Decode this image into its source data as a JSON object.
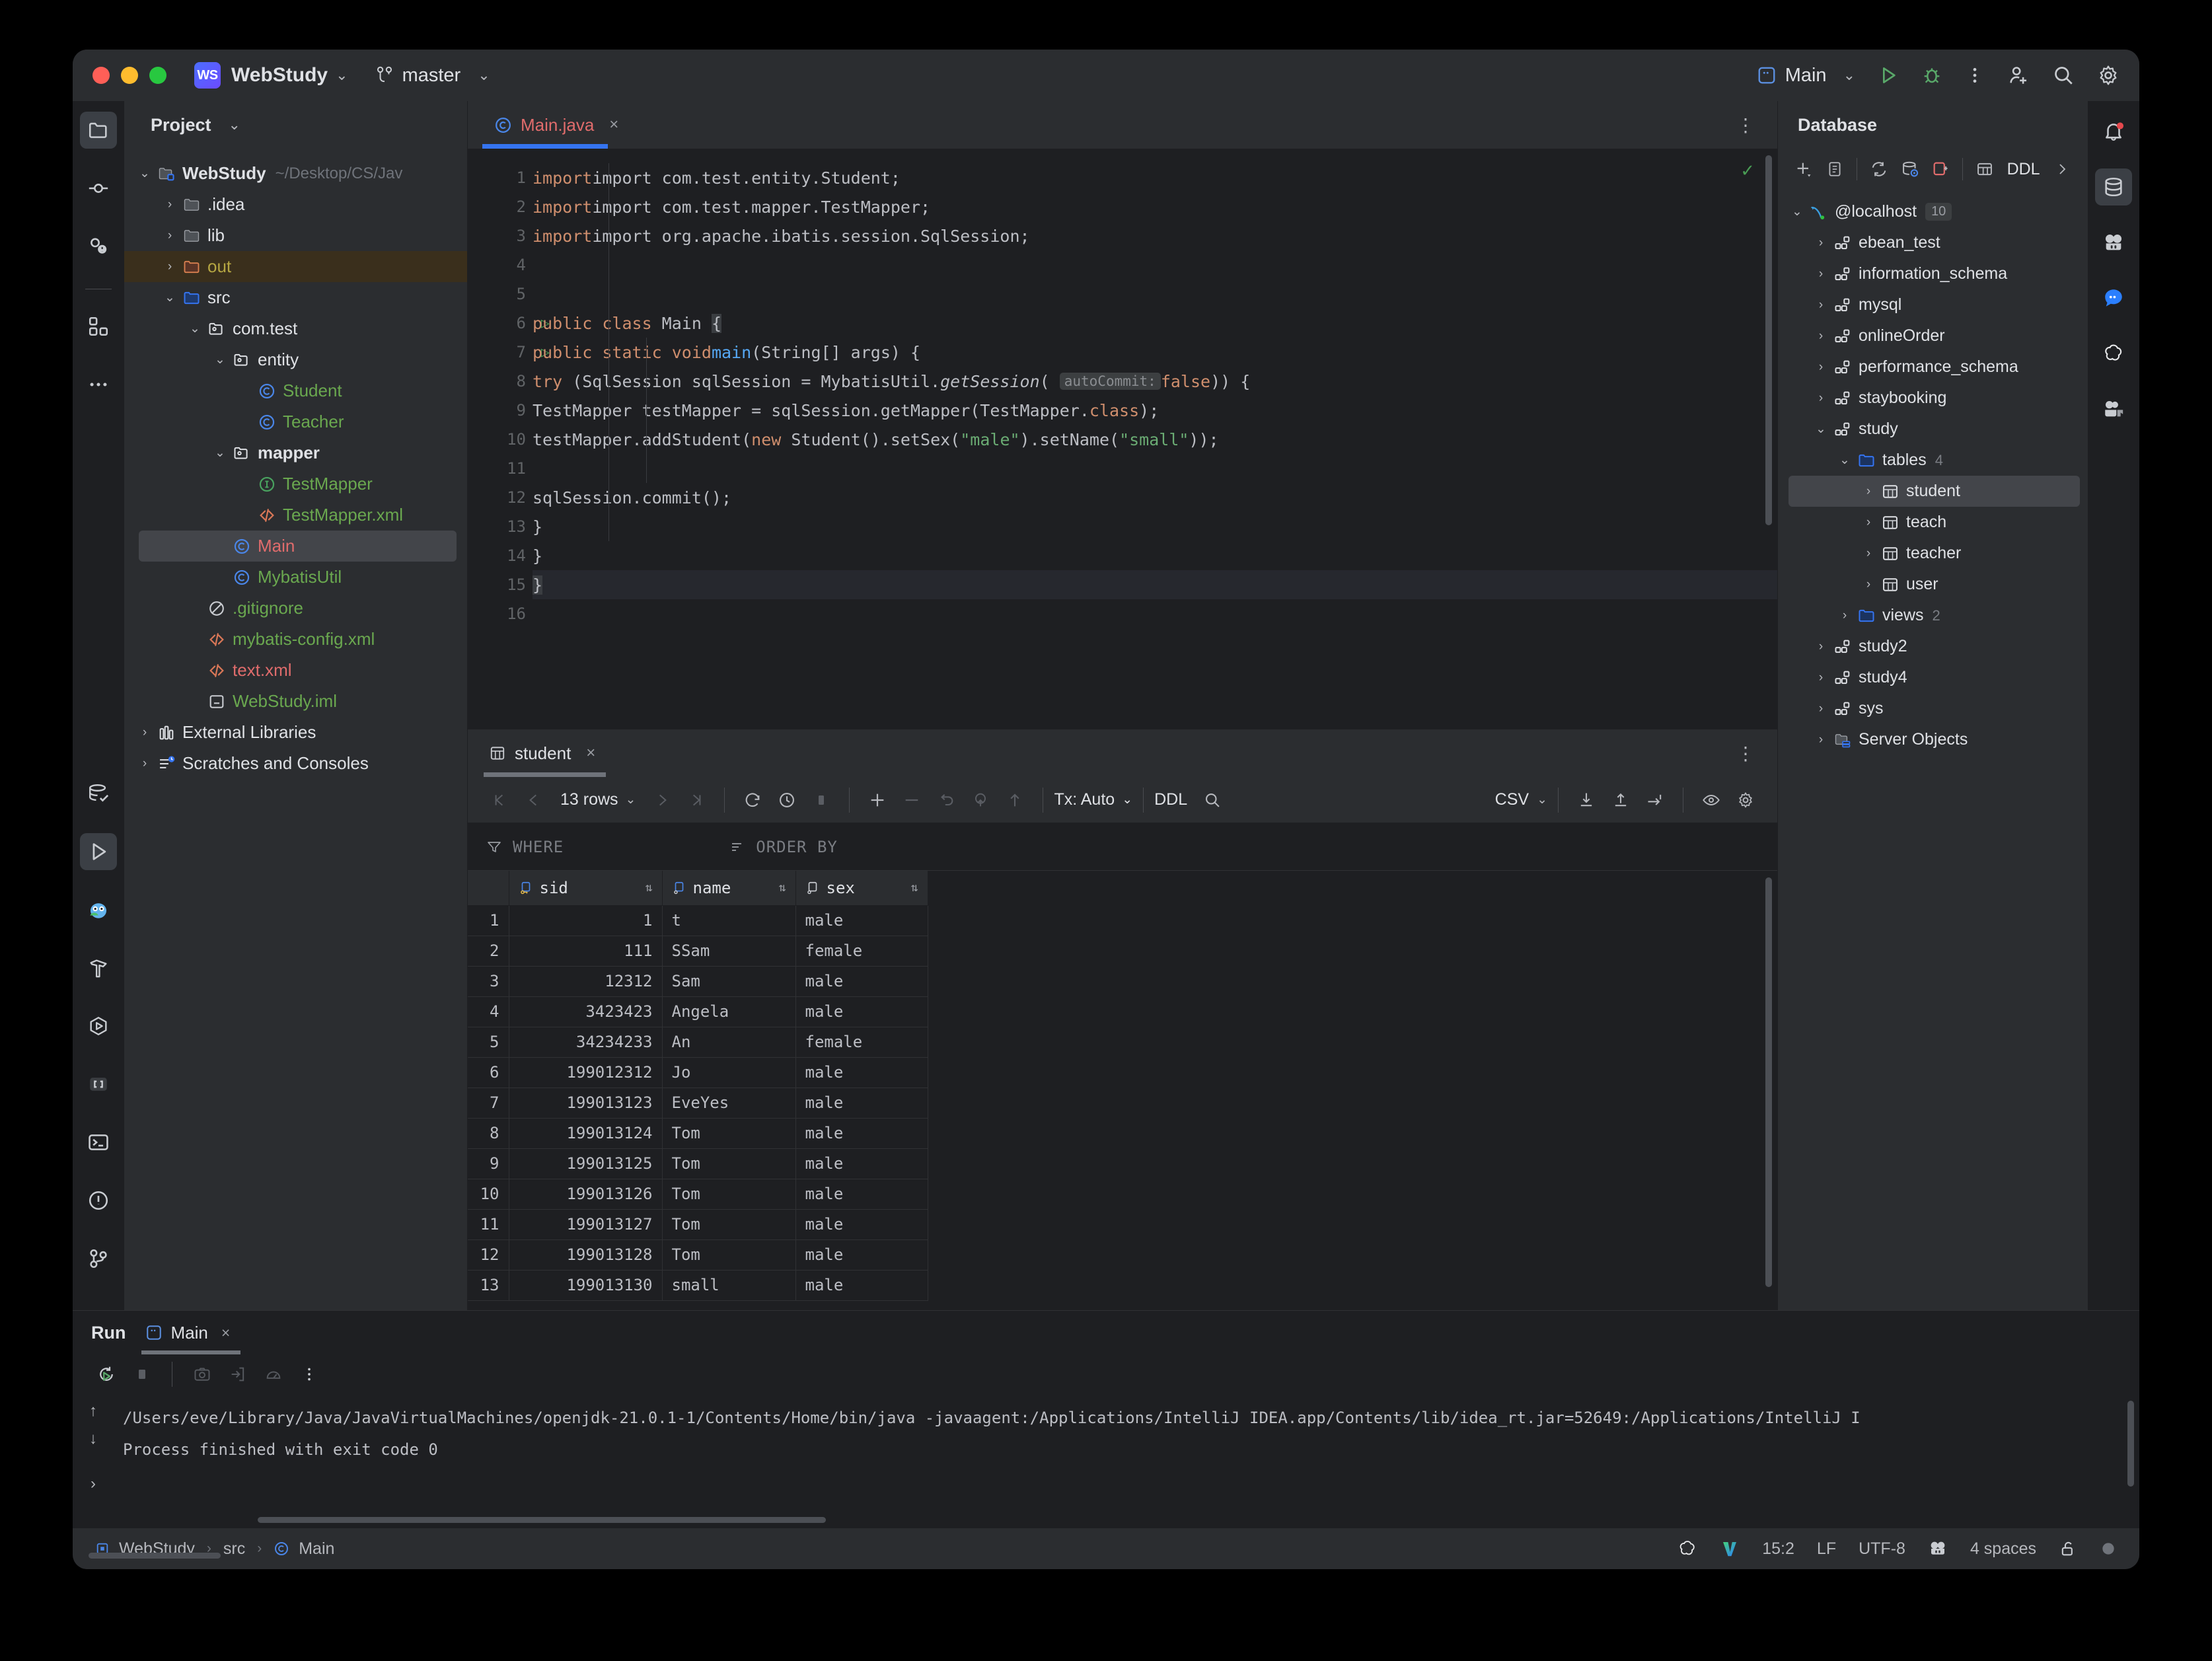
{
  "titlebar": {
    "project_badge": "WS",
    "project_name": "WebStudy",
    "branch": "master",
    "run_config": "Main",
    "icons": [
      "run-icon",
      "debug-icon",
      "more-options-icon",
      "add-user-icon",
      "search-icon",
      "settings-icon"
    ]
  },
  "project_panel": {
    "title": "Project",
    "tree": [
      {
        "label": "WebStudy",
        "path": "~/Desktop/CS/Jav",
        "icon": "module-folder-icon",
        "arrow": "expanded",
        "indent": 0,
        "style": "bold",
        "color": "white",
        "state": "normal"
      },
      {
        "label": ".idea",
        "icon": "folder-icon",
        "arrow": "collapsed",
        "indent": 1,
        "color": "white",
        "state": "normal"
      },
      {
        "label": "lib",
        "icon": "folder-icon",
        "arrow": "collapsed",
        "indent": 1,
        "color": "white",
        "state": "normal"
      },
      {
        "label": "out",
        "icon": "folder-excluded-icon",
        "arrow": "collapsed",
        "indent": 1,
        "color": "yellow",
        "state": "highlighted"
      },
      {
        "label": "src",
        "icon": "source-folder-icon",
        "arrow": "expanded",
        "indent": 1,
        "color": "white",
        "state": "normal"
      },
      {
        "label": "com.test",
        "icon": "package-icon",
        "arrow": "expanded",
        "indent": 2,
        "color": "white",
        "state": "normal"
      },
      {
        "label": "entity",
        "icon": "package-icon",
        "arrow": "expanded",
        "indent": 3,
        "color": "white",
        "state": "normal"
      },
      {
        "label": "Student",
        "icon": "java-class-icon",
        "arrow": "none",
        "indent": 4,
        "color": "green",
        "state": "normal"
      },
      {
        "label": "Teacher",
        "icon": "java-class-icon",
        "arrow": "none",
        "indent": 4,
        "color": "green",
        "state": "normal"
      },
      {
        "label": "mapper",
        "icon": "package-icon",
        "arrow": "expanded",
        "indent": 3,
        "color": "white",
        "style": "bold",
        "state": "normal"
      },
      {
        "label": "TestMapper",
        "icon": "java-interface-icon",
        "arrow": "none",
        "indent": 4,
        "color": "green",
        "state": "normal"
      },
      {
        "label": "TestMapper.xml",
        "icon": "xml-file-icon",
        "arrow": "none",
        "indent": 4,
        "color": "green",
        "state": "normal"
      },
      {
        "label": "Main",
        "icon": "java-class-icon",
        "arrow": "none",
        "indent": 3,
        "color": "red",
        "state": "selected"
      },
      {
        "label": "MybatisUtil",
        "icon": "java-class-icon",
        "arrow": "none",
        "indent": 3,
        "color": "green",
        "state": "normal"
      },
      {
        "label": ".gitignore",
        "icon": "gitignore-icon",
        "arrow": "none",
        "indent": 2,
        "color": "green",
        "state": "normal"
      },
      {
        "label": "mybatis-config.xml",
        "icon": "xml-file-icon",
        "arrow": "none",
        "indent": 2,
        "color": "green",
        "state": "normal"
      },
      {
        "label": "text.xml",
        "icon": "xml-file-icon",
        "arrow": "none",
        "indent": 2,
        "color": "red",
        "state": "normal"
      },
      {
        "label": "WebStudy.iml",
        "icon": "iml-file-icon",
        "arrow": "none",
        "indent": 2,
        "color": "green",
        "state": "normal"
      },
      {
        "label": "External Libraries",
        "icon": "library-icon",
        "arrow": "collapsed",
        "indent": 0,
        "color": "white",
        "state": "normal"
      },
      {
        "label": "Scratches and Consoles",
        "icon": "scratches-icon",
        "arrow": "collapsed",
        "indent": 0,
        "color": "white",
        "state": "normal"
      }
    ]
  },
  "editor": {
    "tab": {
      "label": "Main.java",
      "icon": "java-class-icon",
      "close": "×"
    },
    "lines": [
      {
        "n": "1",
        "run": false
      },
      {
        "n": "2",
        "run": false
      },
      {
        "n": "3",
        "run": false
      },
      {
        "n": "4",
        "run": false
      },
      {
        "n": "5",
        "run": false
      },
      {
        "n": "6",
        "run": true
      },
      {
        "n": "7",
        "run": true
      },
      {
        "n": "8",
        "run": false
      },
      {
        "n": "9",
        "run": false
      },
      {
        "n": "10",
        "run": false
      },
      {
        "n": "11",
        "run": false
      },
      {
        "n": "12",
        "run": false
      },
      {
        "n": "13",
        "run": false
      },
      {
        "n": "14",
        "run": false
      },
      {
        "n": "15",
        "run": false
      },
      {
        "n": "16",
        "run": false
      }
    ],
    "code": {
      "l1": "import com.test.entity.Student;",
      "l2": "import com.test.mapper.TestMapper;",
      "l3": "import org.apache.ibatis.session.SqlSession;",
      "l6": "public class Main {",
      "l7": "public static void main(String[] args) {",
      "l8_a": "try (SqlSession sqlSession = MybatisUtil.",
      "l8_fn": "getSession",
      "l8_hint": "autoCommit:",
      "l8_false": "false",
      "l9": "TestMapper testMapper = sqlSession.getMapper(TestMapper.",
      "l9_class": "class",
      "l10_a": "testMapper.addStudent(",
      "l10_new": "new",
      "l10_b": " Student().setSex(",
      "l10_male": "\"male\"",
      "l10_c": ").setName(",
      "l10_small": "\"small\"",
      "l10_d": "));",
      "l12": "sqlSession.commit();",
      "l13": "}",
      "l14": "}",
      "l15": "}"
    }
  },
  "datagrid": {
    "tab": {
      "label": "student",
      "icon": "table-icon",
      "close": "×"
    },
    "toolbar": {
      "first_page": "first-page-icon",
      "prev_page": "prev-page-icon",
      "rows_label": "13 rows",
      "next_page": "next-page-icon",
      "last_page": "last-page-icon",
      "reload": "reload-icon",
      "history": "history-icon",
      "stop": "stop-icon",
      "add_row": "add-row-icon",
      "delete_row": "delete-row-icon",
      "revert": "revert-icon",
      "revert_sel": "revert-selection-icon",
      "submit": "submit-icon",
      "tx_label": "Tx: Auto",
      "ddl_label": "DDL",
      "search": "search-icon",
      "csv_label": "CSV",
      "download": "download-icon",
      "upload": "upload-icon",
      "goto": "goto-icon",
      "view": "view-options-icon",
      "settings": "settings-icon"
    },
    "filters": {
      "where": "WHERE",
      "order_by": "ORDER BY"
    },
    "columns": [
      {
        "label": "sid",
        "icon": "primary-key-icon"
      },
      {
        "label": "name",
        "icon": "column-icon"
      },
      {
        "label": "sex",
        "icon": "column-icon"
      }
    ],
    "rows": [
      {
        "n": "1",
        "sid": "1",
        "name": "t",
        "sex": "male"
      },
      {
        "n": "2",
        "sid": "111",
        "name": "SSam",
        "sex": "female"
      },
      {
        "n": "3",
        "sid": "12312",
        "name": "Sam",
        "sex": "male"
      },
      {
        "n": "4",
        "sid": "3423423",
        "name": "Angela",
        "sex": "male"
      },
      {
        "n": "5",
        "sid": "34234233",
        "name": "An",
        "sex": "female"
      },
      {
        "n": "6",
        "sid": "199012312",
        "name": "Jo",
        "sex": "male"
      },
      {
        "n": "7",
        "sid": "199013123",
        "name": "EveYes",
        "sex": "male"
      },
      {
        "n": "8",
        "sid": "199013124",
        "name": "Tom",
        "sex": "male"
      },
      {
        "n": "9",
        "sid": "199013125",
        "name": "Tom",
        "sex": "male"
      },
      {
        "n": "10",
        "sid": "199013126",
        "name": "Tom",
        "sex": "male"
      },
      {
        "n": "11",
        "sid": "199013127",
        "name": "Tom",
        "sex": "male"
      },
      {
        "n": "12",
        "sid": "199013128",
        "name": "Tom",
        "sex": "male"
      },
      {
        "n": "13",
        "sid": "199013130",
        "name": "small",
        "sex": "male"
      }
    ]
  },
  "database_panel": {
    "title": "Database",
    "toolbar": [
      "add-icon",
      "duplicate-icon",
      "sync-icon",
      "db-settings-icon",
      "disconnect-icon",
      "table-icon",
      "DDL",
      "expand-icon"
    ],
    "ddl_label": "DDL",
    "tree": [
      {
        "label": "@localhost",
        "badge": "10",
        "icon": "mysql-icon",
        "arrow": "expanded",
        "indent": 0,
        "state": "normal"
      },
      {
        "label": "ebean_test",
        "icon": "schema-icon",
        "arrow": "collapsed",
        "indent": 1,
        "state": "normal"
      },
      {
        "label": "information_schema",
        "icon": "schema-icon",
        "arrow": "collapsed",
        "indent": 1,
        "state": "normal"
      },
      {
        "label": "mysql",
        "icon": "schema-icon",
        "arrow": "collapsed",
        "indent": 1,
        "state": "normal"
      },
      {
        "label": "onlineOrder",
        "icon": "schema-icon",
        "arrow": "collapsed",
        "indent": 1,
        "state": "normal"
      },
      {
        "label": "performance_schema",
        "icon": "schema-icon",
        "arrow": "collapsed",
        "indent": 1,
        "state": "normal"
      },
      {
        "label": "staybooking",
        "icon": "schema-icon",
        "arrow": "collapsed",
        "indent": 1,
        "state": "normal"
      },
      {
        "label": "study",
        "icon": "schema-icon",
        "arrow": "expanded",
        "indent": 1,
        "state": "normal"
      },
      {
        "label": "tables",
        "count": "4",
        "icon": "folder-blue-icon",
        "arrow": "expanded",
        "indent": 2,
        "state": "normal"
      },
      {
        "label": "student",
        "icon": "table-icon",
        "arrow": "collapsed",
        "indent": 3,
        "state": "selected"
      },
      {
        "label": "teach",
        "icon": "table-icon",
        "arrow": "collapsed",
        "indent": 3,
        "state": "normal"
      },
      {
        "label": "teacher",
        "icon": "table-icon",
        "arrow": "collapsed",
        "indent": 3,
        "state": "normal"
      },
      {
        "label": "user",
        "icon": "table-icon",
        "arrow": "collapsed",
        "indent": 3,
        "state": "normal"
      },
      {
        "label": "views",
        "count": "2",
        "icon": "folder-blue-icon",
        "arrow": "collapsed",
        "indent": 2,
        "state": "normal"
      },
      {
        "label": "study2",
        "icon": "schema-icon",
        "arrow": "collapsed",
        "indent": 1,
        "state": "normal"
      },
      {
        "label": "study4",
        "icon": "schema-icon",
        "arrow": "collapsed",
        "indent": 1,
        "state": "normal"
      },
      {
        "label": "sys",
        "icon": "schema-icon",
        "arrow": "collapsed",
        "indent": 1,
        "state": "normal"
      },
      {
        "label": "Server Objects",
        "icon": "server-objects-icon",
        "arrow": "collapsed",
        "indent": 1,
        "state": "normal"
      }
    ]
  },
  "run_panel": {
    "title": "Run",
    "tab": {
      "label": "Main",
      "icon": "run-config-icon",
      "close": "×"
    },
    "console": {
      "command": "/Users/eve/Library/Java/JavaVirtualMachines/openjdk-21.0.1-1/Contents/Home/bin/java -javaagent:/Applications/IntelliJ IDEA.app/Contents/lib/idea_rt.jar=52649:/Applications/IntelliJ I",
      "result": "Process finished with exit code 0"
    }
  },
  "statusbar": {
    "breadcrumb": [
      "WebStudy",
      "src",
      "Main"
    ],
    "position": "15:2",
    "line_separator": "LF",
    "encoding": "UTF-8",
    "indent": "4 spaces",
    "icons": [
      "openai-icon",
      "vim-icon",
      "branch-icon",
      "lock-icon",
      "status-indicator"
    ]
  },
  "left_rail": [
    "project-icon",
    "commit-icon",
    "pull-requests-icon",
    "structure-icon",
    "more-tools-icon",
    "database-check-icon",
    "run-icon",
    "owl-icon",
    "build-icon",
    "services-icon",
    "brackets-icon",
    "terminal-icon",
    "problems-icon",
    "version-control-icon"
  ],
  "right_rail": [
    "notifications-icon",
    "database-icon",
    "ai-assistant-icon",
    "chat-icon",
    "openai-icon",
    "meet-icon"
  ],
  "colors": {
    "accent": "#3574f0",
    "green": "#6aa84f",
    "red": "#e06c6c",
    "bg_dark": "#1e1f22",
    "bg_panel": "#2b2d30"
  }
}
